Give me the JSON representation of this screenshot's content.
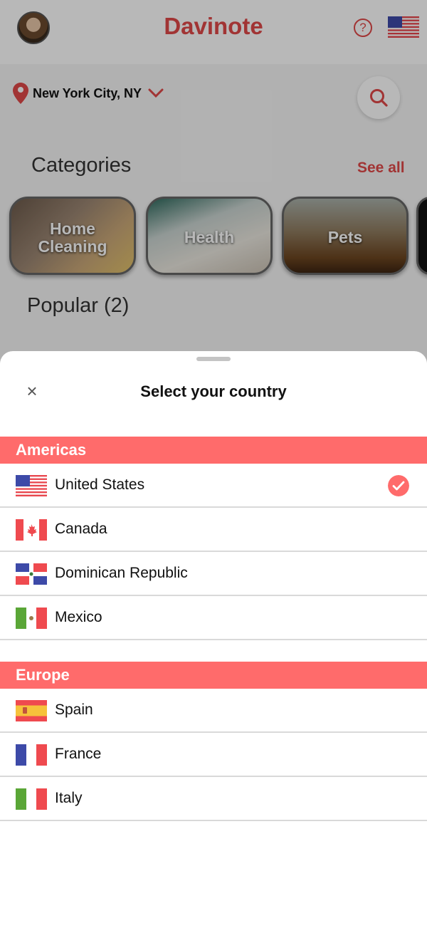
{
  "colors": {
    "accent": "#ff6b6b",
    "brand": "#e04848",
    "divider": "#d9d9d9"
  },
  "header": {
    "brand": "Davinote",
    "help_icon": "?"
  },
  "location": {
    "city": "New York City, NY"
  },
  "categories": {
    "title": "Categories",
    "see_all": "See all",
    "items": [
      {
        "label_line1": "Home",
        "label_line2": "Cleaning"
      },
      {
        "label_line1": "Health"
      },
      {
        "label_line1": "Pets"
      }
    ]
  },
  "popular": {
    "title": "Popular (2)"
  },
  "sheet": {
    "title": "Select your country",
    "close_icon": "×",
    "regions": [
      {
        "name": "Americas",
        "countries": [
          {
            "name": "United States",
            "flag": "us-flag",
            "selected": true
          },
          {
            "name": "Canada",
            "flag": "ca-flag",
            "selected": false
          },
          {
            "name": "Dominican Republic",
            "flag": "do-flag",
            "selected": false
          },
          {
            "name": "Mexico",
            "flag": "mx-flag",
            "selected": false
          }
        ]
      },
      {
        "name": "Europe",
        "countries": [
          {
            "name": "Spain",
            "flag": "es-flag",
            "selected": false
          },
          {
            "name": "France",
            "flag": "fr-flag",
            "selected": false
          },
          {
            "name": "Italy",
            "flag": "it-flag",
            "selected": false
          }
        ]
      }
    ]
  }
}
